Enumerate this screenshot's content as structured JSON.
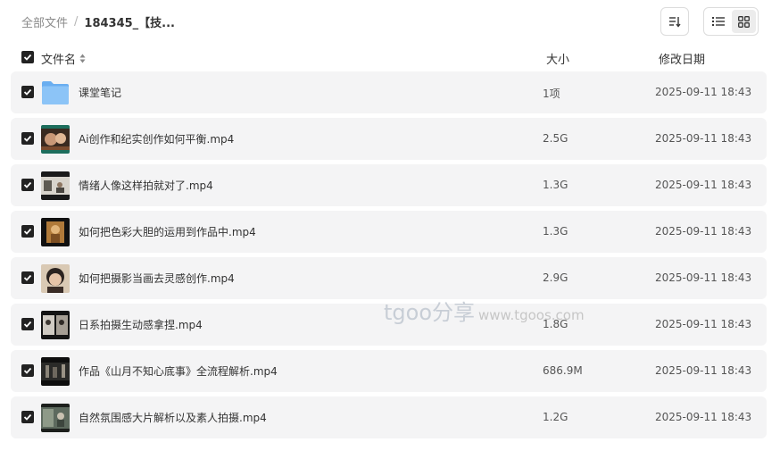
{
  "breadcrumb": {
    "root": "全部文件",
    "separator": "/",
    "current": "184345_【技..."
  },
  "toolbar": {
    "sort_icon": "sort-icon",
    "list_view_icon": "list-view-icon",
    "grid_view_icon": "grid-view-icon",
    "active_view": "list"
  },
  "columns": {
    "name": "文件名",
    "size": "大小",
    "modified": "修改日期"
  },
  "files": [
    {
      "name": "课堂笔记",
      "size": "1项",
      "modified": "2025-09-11 18:43",
      "type": "folder",
      "checked": true
    },
    {
      "name": "Ai创作和纪实创作如何平衡.mp4",
      "size": "2.5G",
      "modified": "2025-09-11 18:43",
      "type": "video",
      "checked": true
    },
    {
      "name": "情绪人像这样拍就对了.mp4",
      "size": "1.3G",
      "modified": "2025-09-11 18:43",
      "type": "video",
      "checked": true
    },
    {
      "name": "如何把色彩大胆的运用到作品中.mp4",
      "size": "1.3G",
      "modified": "2025-09-11 18:43",
      "type": "video",
      "checked": true
    },
    {
      "name": "如何把摄影当画去灵感创作.mp4",
      "size": "2.9G",
      "modified": "2025-09-11 18:43",
      "type": "video",
      "checked": true
    },
    {
      "name": "日系拍摄生动感拿捏.mp4",
      "size": "1.8G",
      "modified": "2025-09-11 18:43",
      "type": "video",
      "checked": true
    },
    {
      "name": "作品《山月不知心底事》全流程解析.mp4",
      "size": "686.9M",
      "modified": "2025-09-11 18:43",
      "type": "video",
      "checked": true
    },
    {
      "name": "自然氛围感大片解析以及素人拍摄.mp4",
      "size": "1.2G",
      "modified": "2025-09-11 18:43",
      "type": "video",
      "checked": true
    }
  ],
  "watermark": {
    "brand": "tgoo分享",
    "url": "www.tgoos.com"
  },
  "colors": {
    "row_background": "#f4f4f5",
    "checkbox": "#222222",
    "folder": "#7ab8f5"
  }
}
